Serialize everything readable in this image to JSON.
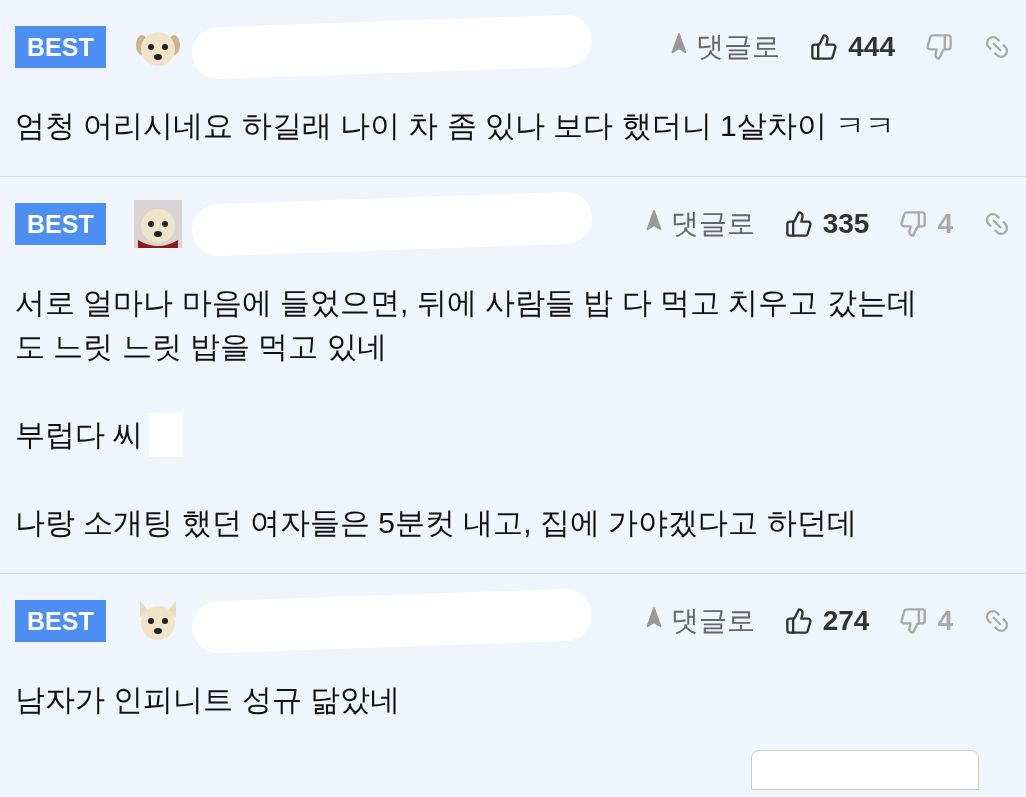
{
  "comments": [
    {
      "badge": "BEST",
      "avatar": {
        "kind": "puppy"
      },
      "reply": "댓글로",
      "likes": "444",
      "paragraphs": [
        {
          "text": "엄청 어리시네요 하길래 나이 차 좀 있나 보다 했더니 1살차이 ㅋㅋ",
          "redacted": false
        }
      ]
    },
    {
      "badge": "BEST",
      "avatar": {
        "kind": "bear"
      },
      "reply": "댓글로",
      "likes": "335",
      "dislikes": "4",
      "paragraphs": [
        {
          "text": "서로 얼마나 마음에 들었으면, 뒤에 사람들 밥 다 먹고 치우고 갔는데도 느릿 느릿 밥을 먹고 있네",
          "redacted": false
        },
        {
          "text": "부럽다 씨",
          "redacted": true
        },
        {
          "text": "나랑 소개팅 했던 여자들은 5분컷 내고, 집에 가야겠다고 하던데",
          "redacted": false
        }
      ]
    },
    {
      "badge": "BEST",
      "avatar": {
        "kind": "fox"
      },
      "reply": "댓글로",
      "likes": "274",
      "dislikes": "4",
      "paragraphs": [
        {
          "text": "남자가 인피니트 성규 닮았네",
          "redacted": false
        }
      ]
    }
  ]
}
